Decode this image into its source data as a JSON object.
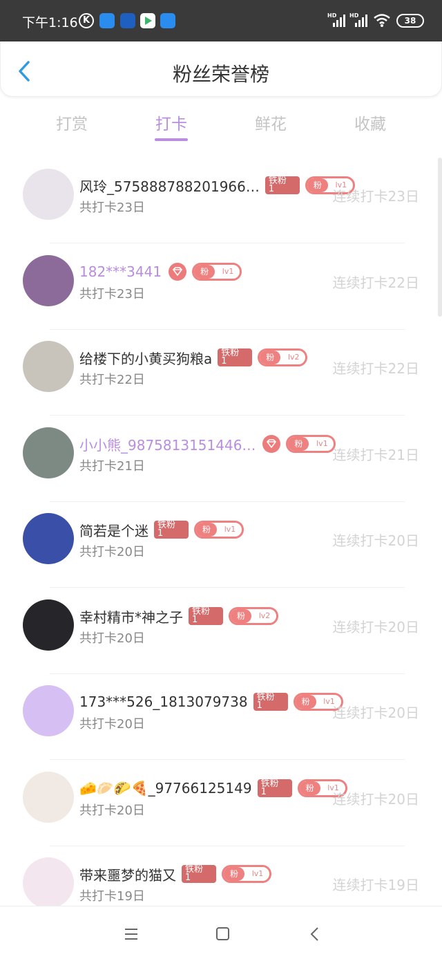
{
  "status_bar": {
    "time": "下午1:16",
    "k_icon": "K",
    "battery": "38",
    "signal_label": "HD"
  },
  "header": {
    "title": "粉丝荣誉榜",
    "back_icon": "chevron-left-icon"
  },
  "tabs": [
    {
      "label": "打赏",
      "active": false
    },
    {
      "label": "打卡",
      "active": true
    },
    {
      "label": "鲜花",
      "active": false
    },
    {
      "label": "收藏",
      "active": false
    }
  ],
  "badges": {
    "iron_line1": "铁粉",
    "iron_line2": "1",
    "fan_tag": "粉"
  },
  "rows": [
    {
      "name": "风玲_575888788201966…",
      "total": "共打卡23日",
      "streak": "连续打卡23日",
      "iron": true,
      "gem": false,
      "level": "lv1",
      "vip": false,
      "avatar_color": "#e9e3ec"
    },
    {
      "name": "182***3441",
      "total": "共打卡23日",
      "streak": "连续打卡22日",
      "iron": false,
      "gem": true,
      "level": "lv1",
      "vip": true,
      "avatar_color": "#8c6a9a"
    },
    {
      "name": "给楼下的小黄买狗粮a",
      "total": "共打卡22日",
      "streak": "连续打卡22日",
      "iron": true,
      "gem": false,
      "level": "lv2",
      "vip": false,
      "avatar_color": "#c9c4bb"
    },
    {
      "name": "小小熊_9875813151446…",
      "total": "共打卡21日",
      "streak": "连续打卡21日",
      "iron": false,
      "gem": true,
      "level": "lv1",
      "vip": true,
      "avatar_color": "#7d8a83"
    },
    {
      "name": "简若是个迷",
      "total": "共打卡20日",
      "streak": "连续打卡20日",
      "iron": true,
      "gem": false,
      "level": "lv1",
      "vip": false,
      "avatar_color": "#3a4fa8"
    },
    {
      "name": "幸村精市*神之子",
      "total": "共打卡20日",
      "streak": "连续打卡20日",
      "iron": true,
      "gem": false,
      "level": "lv2",
      "vip": false,
      "avatar_color": "#26262a"
    },
    {
      "name": "173***526_1813079738",
      "total": "共打卡20日",
      "streak": "连续打卡20日",
      "iron": true,
      "gem": false,
      "level": "lv1",
      "vip": false,
      "avatar_color": "#d6bff2"
    },
    {
      "name": "🧀🥟🌮🍕_97766125149",
      "total": "共打卡20日",
      "streak": "连续打卡20日",
      "iron": true,
      "gem": false,
      "level": "lv1",
      "vip": false,
      "avatar_color": "#f1e9e4"
    },
    {
      "name": "带来噩梦的猫又",
      "total": "共打卡19日",
      "streak": "连续打卡19日",
      "iron": true,
      "gem": false,
      "level": "lv1",
      "vip": false,
      "avatar_color": "#f3e6ef"
    }
  ],
  "nav": {
    "menu_icon": "menu-icon",
    "home_icon": "home-square-icon",
    "back_icon": "back-triangle-icon"
  },
  "colors": {
    "accent": "#b98de0",
    "badge_red": "#d46a6a",
    "fan_pink": "#ee8080",
    "status_bar": "#3a3a3a"
  }
}
